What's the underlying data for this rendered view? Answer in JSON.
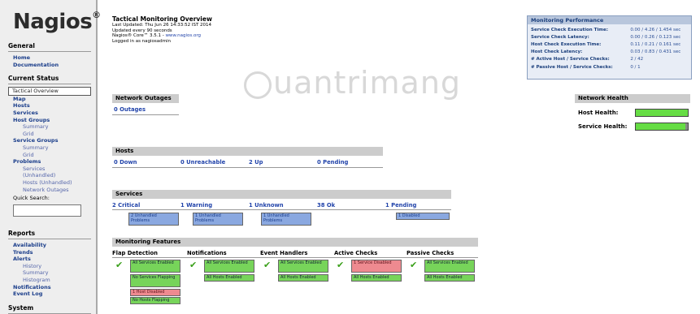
{
  "sidebar": {
    "logo": "Nagios",
    "logo_mark": "®",
    "general_head": "General",
    "general_items": [
      "Home",
      "Documentation"
    ],
    "current_status_head": "Current Status",
    "status_items": {
      "tactical": "Tactical Overview",
      "map": "Map",
      "hosts": "Hosts",
      "services": "Services",
      "host_groups": "Host Groups",
      "hg_summary": "Summary",
      "hg_grid": "Grid",
      "service_groups": "Service Groups",
      "sg_summary": "Summary",
      "sg_grid": "Grid",
      "problems": "Problems",
      "p_services": "Services",
      "p_unhandled": "(Unhandled)",
      "p_hosts_unhandled": "Hosts (Unhandled)",
      "p_network_outages": "Network Outages"
    },
    "quick_search_label": "Quick Search:",
    "reports_head": "Reports",
    "report_items": {
      "availability": "Availability",
      "trends": "Trends",
      "alerts": "Alerts",
      "a_history": "History",
      "a_summary": "Summary",
      "a_histogram": "Histogram",
      "notifications": "Notifications",
      "event_log": "Event Log"
    },
    "system_head": "System"
  },
  "header": {
    "title": "Tactical Monitoring Overview",
    "last_updated": "Last Updated: Thu Jun 26 14:33:52 IST 2014",
    "update_interval": "Updated every 90 seconds",
    "version": "Nagios® Core™ 3.5.1 - ",
    "version_link": "www.nagios.org",
    "logged_in": "Logged in as nagiosadmin"
  },
  "performance": {
    "title": "Monitoring Performance",
    "rows": [
      {
        "label": "Service Check Execution Time:",
        "value": "0.00 / 4.26 / 1.454 sec"
      },
      {
        "label": "Service Check Latency:",
        "value": "0.00 / 0.26 / 0.123 sec"
      },
      {
        "label": "Host Check Execution Time:",
        "value": "0.11 / 0.21 / 0.161 sec"
      },
      {
        "label": "Host Check Latency:",
        "value": "0.03 / 0.83 / 0.431 sec"
      },
      {
        "label": "# Active Host / Service Checks:",
        "value": "2 / 42"
      },
      {
        "label": "# Passive Host / Service Checks:",
        "value": "0 / 1"
      }
    ]
  },
  "watermark": "uantrimang",
  "network_outages": {
    "title": "Network Outages",
    "outages": "0 Outages"
  },
  "network_health": {
    "title": "Network Health",
    "host_label": "Host Health:",
    "service_label": "Service Health:",
    "host_health_fraction": 1.0,
    "service_health_fraction": 0.95
  },
  "hosts": {
    "title": "Hosts",
    "down": "0 Down",
    "unreachable": "0 Unreachable",
    "up": "2 Up",
    "pending": "0 Pending"
  },
  "services": {
    "title": "Services",
    "critical": "2 Critical",
    "warning": "1 Warning",
    "unknown": "1 Unknown",
    "ok": "38 Ok",
    "pending": "1 Pending",
    "critical_box": "2 Unhandled Problems",
    "warning_box": "1 Unhandled Problems",
    "unknown_box": "1 Unhandled Problems",
    "pending_box": "1 Disabled"
  },
  "features": {
    "title": "Monitoring Features",
    "columns": {
      "flap": "Flap Detection",
      "notifications": "Notifications",
      "event_handlers": "Event Handlers",
      "active": "Active Checks",
      "passive": "Passive Checks"
    },
    "flap_boxes": [
      "All Services Enabled",
      "No Services Flapping",
      "1 Host Disabled",
      "No Hosts Flapping"
    ],
    "notif_boxes": [
      "All Services Enabled",
      "All Hosts Enabled"
    ],
    "event_boxes": [
      "All Services Enabled",
      "All Hosts Enabled"
    ],
    "active_boxes": [
      "1 Service Disabled",
      "All Hosts Enabled"
    ],
    "passive_boxes": [
      "All Services Enabled",
      "All Hosts Enabled"
    ],
    "check_glyph": "✔"
  },
  "colors": {
    "ok": "#77d45a",
    "problem": "#8aa8e0",
    "disabled": "#ee8a90",
    "health": "#66dd44"
  }
}
